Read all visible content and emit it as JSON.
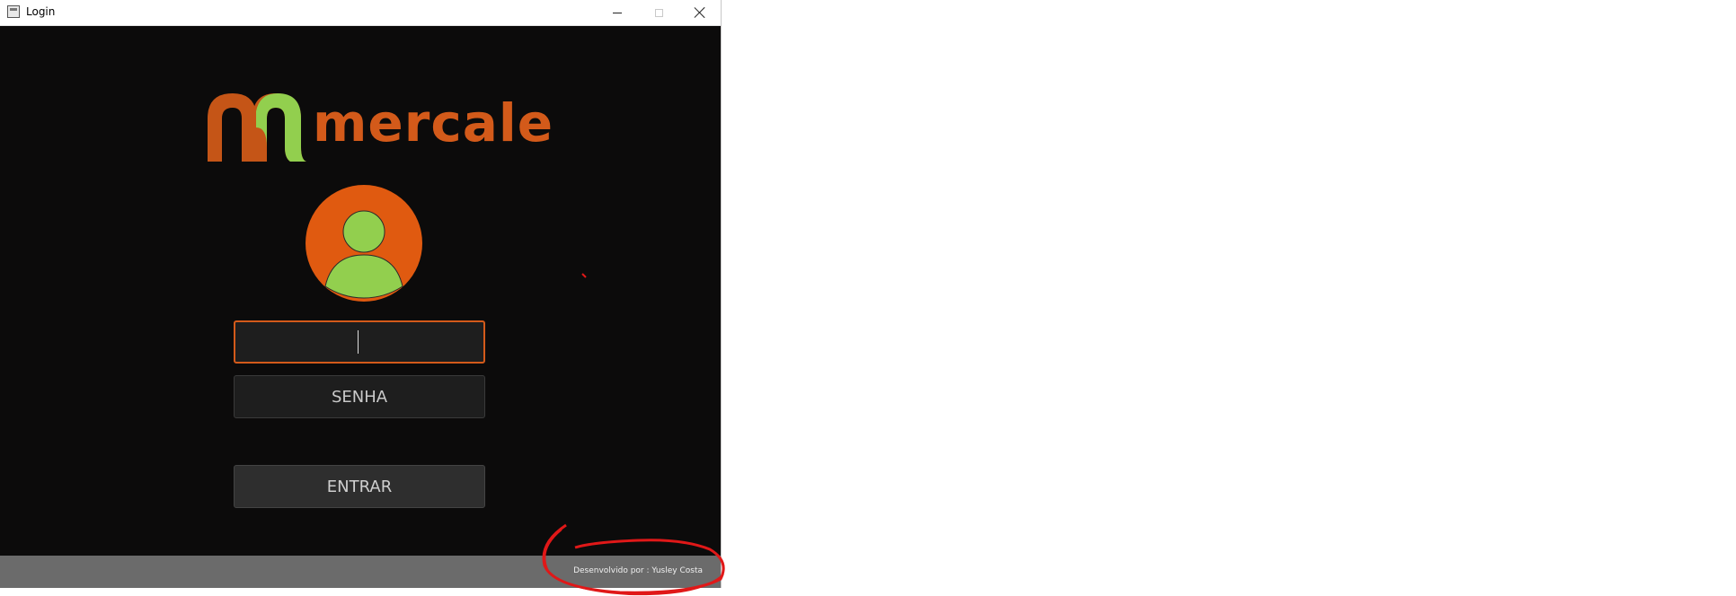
{
  "window": {
    "title": "Login",
    "controls": {
      "minimize": "minimize",
      "maximize": "maximize",
      "close": "close"
    }
  },
  "logo": {
    "text": "mercale",
    "brand_orange": "#d35a1a",
    "brand_green": "#92cf4e"
  },
  "avatar": {
    "icon": "user-avatar-icon",
    "bg_color": "#e05a10",
    "fg_color": "#92cf4e"
  },
  "form": {
    "username": {
      "value": "",
      "placeholder": ""
    },
    "password": {
      "value": "",
      "placeholder": "SENHA"
    },
    "submit_label": "ENTRAR"
  },
  "footer": {
    "credit": "Desenvolvido por : Yusley Costa"
  },
  "annotation": {
    "color": "#e01818"
  }
}
